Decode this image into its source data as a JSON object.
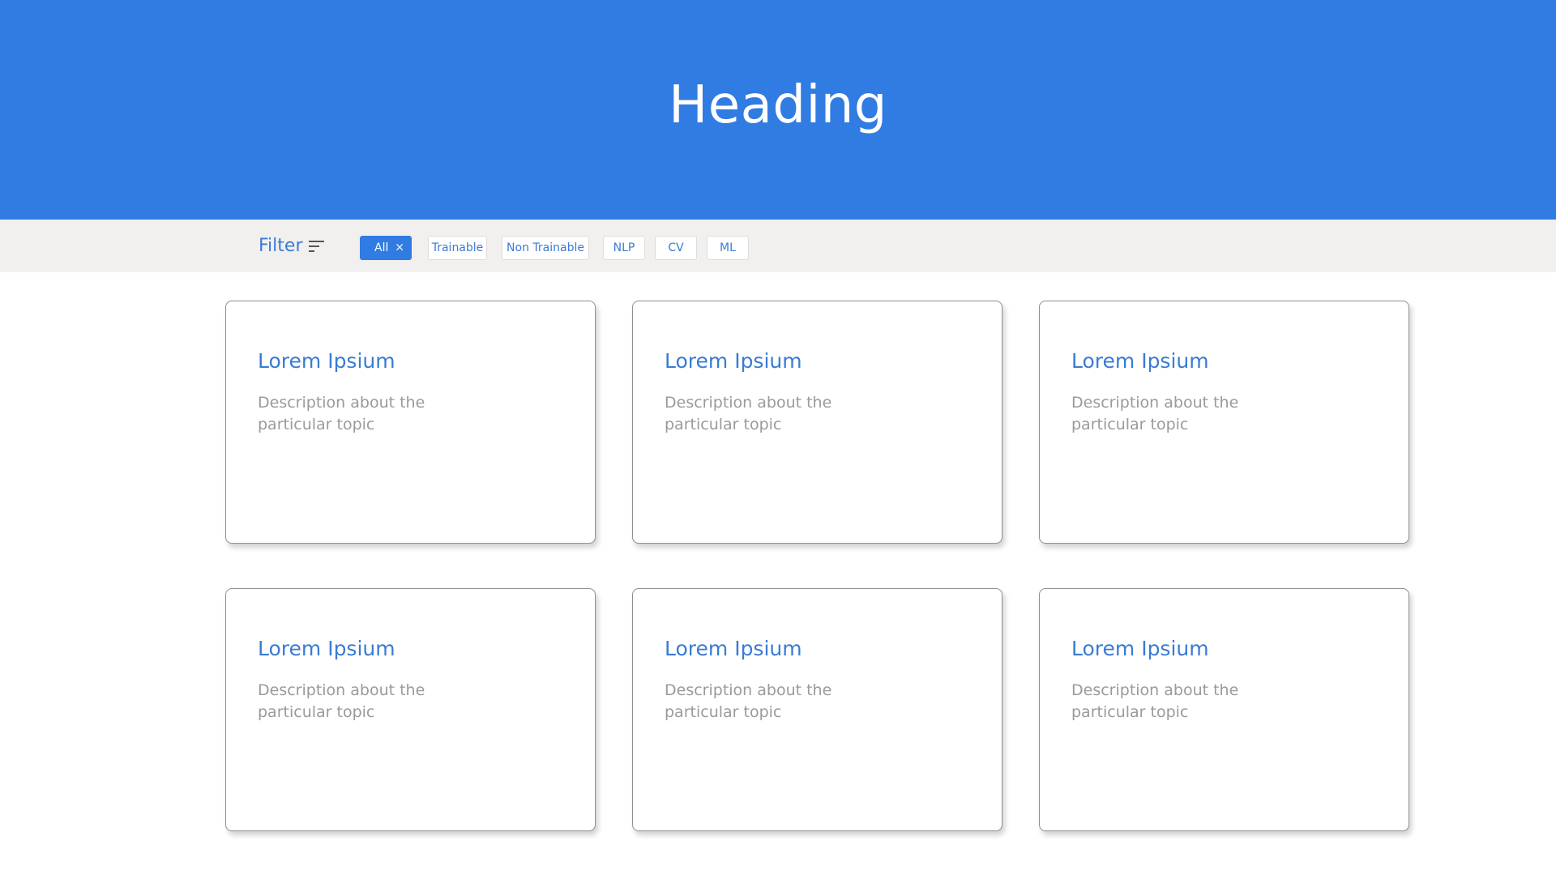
{
  "hero": {
    "title": "Heading",
    "background": "#317ce2"
  },
  "filter": {
    "label": "Filter",
    "icon": "sort-lines-icon",
    "chips": [
      {
        "label": "All",
        "active": true,
        "close_glyph": "×"
      },
      {
        "label": "Trainable",
        "active": false
      },
      {
        "label": "Non Trainable",
        "active": false
      },
      {
        "label": "NLP",
        "active": false
      },
      {
        "label": "CV",
        "active": false
      },
      {
        "label": "ML",
        "active": false
      }
    ]
  },
  "cards": [
    {
      "title": "Lorem Ipsium",
      "description": "Description about the particular topic"
    },
    {
      "title": "Lorem Ipsium",
      "description": "Description about the particular topic"
    },
    {
      "title": "Lorem Ipsium",
      "description": "Description about the particular topic"
    },
    {
      "title": "Lorem Ipsium",
      "description": "Description about the particular topic"
    },
    {
      "title": "Lorem Ipsium",
      "description": "Description about the particular topic"
    },
    {
      "title": "Lorem Ipsium",
      "description": "Description about the particular topic"
    }
  ],
  "colors": {
    "accent": "#317ce2",
    "link": "#3a7bd5",
    "muted_text": "#9a9a9a",
    "filter_bar": "#f1f0ee"
  }
}
